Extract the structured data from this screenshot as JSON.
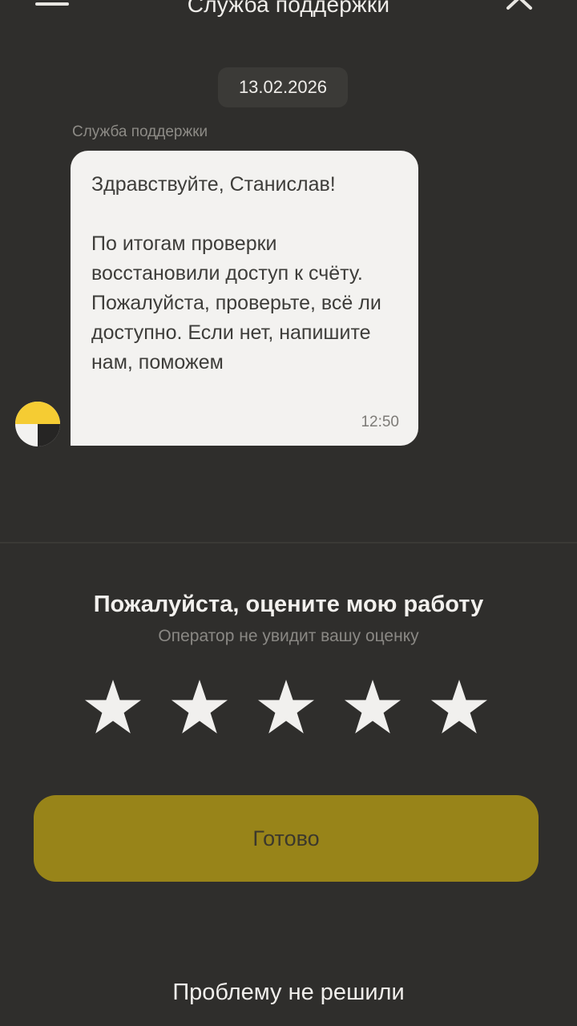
{
  "header": {
    "title": "Служба поддержки",
    "menu_icon": "hamburger-menu-icon",
    "close_icon": "close-icon"
  },
  "chat": {
    "date": "13.02.2026",
    "sender": "Служба поддержки",
    "message": {
      "text": "Здравствуйте, Станислав!\n\nПо итогам проверки восстановили доступ к счёту. Пожалуйста, проверьте, всё ли доступно. Если нет, напишите нам, поможем",
      "time": "12:50"
    },
    "avatar_icon": "support-avatar-icon"
  },
  "rating": {
    "title": "Пожалуйста, оцените мою работу",
    "subtitle": "Оператор не увидит вашу оценку",
    "max_stars": 5,
    "selected_stars": 0
  },
  "actions": {
    "done_label": "Готово",
    "problem_link": "Проблему не решили"
  },
  "colors": {
    "background": "#2f2e2c",
    "accent_yellow": "#f5cc33",
    "button": "#988419",
    "bubble": "#f3f2f0"
  }
}
